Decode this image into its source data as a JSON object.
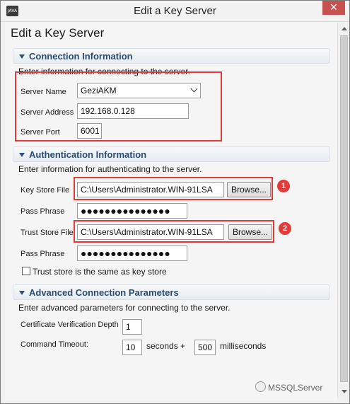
{
  "window": {
    "title": "Edit a Key Server",
    "close_glyph": "✕",
    "app_icon_text": "JAVA"
  },
  "page": {
    "title": "Edit a Key Server"
  },
  "connection": {
    "header": "Connection Information",
    "description": "Enter information for connecting to the server.",
    "server_name_label": "Server Name",
    "server_name_value": "GeziAKM",
    "server_address_label": "Server Address",
    "server_address_value": "192.168.0.128",
    "server_port_label": "Server Port",
    "server_port_value": "6001"
  },
  "authentication": {
    "header": "Authentication Information",
    "description": "Enter information for authenticating to the server.",
    "key_store_label": "Key Store File",
    "key_store_value": "C:\\Users\\Administrator.WIN-91LSA",
    "browse_label_1": "Browse...",
    "pass_phrase_label_1": "Pass Phrase",
    "pass_phrase_value_1": "●●●●●●●●●●●●●●●",
    "trust_store_label": "Trust Store File",
    "trust_store_value": "C:\\Users\\Administrator.WIN-91LSA",
    "browse_label_2": "Browse...",
    "pass_phrase_label_2": "Pass Phrase",
    "pass_phrase_value_2": "●●●●●●●●●●●●●●●",
    "same_as_key_store_label": "Trust store is the same as key store",
    "same_as_key_store_checked": false
  },
  "advanced": {
    "header": "Advanced Connection Parameters",
    "description": "Enter advanced parameters for connecting to the server.",
    "cert_depth_label": "Certificate Verification Depth",
    "cert_depth_value": "1",
    "timeout_label": "Command Timeout:",
    "timeout_seconds_value": "10",
    "seconds_plus_label": "seconds +",
    "timeout_ms_value": "500",
    "milliseconds_label": "milliseconds"
  },
  "annotations": {
    "badge_1": "1",
    "badge_2": "2",
    "highlight_color": "#e23a3a"
  },
  "watermark": {
    "text": "MSSQLServer"
  }
}
